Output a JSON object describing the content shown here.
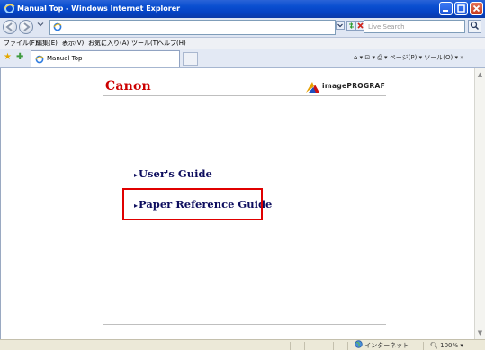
{
  "window": {
    "title": "Manual Top - Windows Internet Explorer"
  },
  "toolbar": {
    "search_placeholder": "Live Search"
  },
  "menu": {
    "items": [
      "ファイル(F)",
      "編集(E)",
      "表示(V)",
      "お気に入り(A)",
      "ツール(T)",
      "ヘルプ(H)"
    ]
  },
  "tabs": {
    "active_label": "Manual Top"
  },
  "commandbar": {
    "text": "⌂ ▾ ⊡ ▾ ⎙ ▾ ページ(P) ▾ ツール(O) ▾ »"
  },
  "page": {
    "logo_text": "Canon",
    "brand_text": "imagePROGRAF",
    "links": [
      {
        "label": "User's Guide"
      },
      {
        "label": "Paper Reference Guide"
      }
    ]
  },
  "statusbar": {
    "zone": "インターネット",
    "zoom": "100%"
  },
  "colors": {
    "titlebar": "#0542c4",
    "canon_red": "#cc0000",
    "link": "#0d0d5e",
    "highlight_box": "#e00000"
  }
}
